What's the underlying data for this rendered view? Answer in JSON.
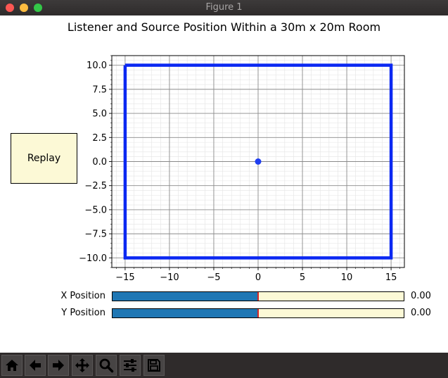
{
  "window": {
    "title": "Figure 1"
  },
  "figure": {
    "title": "Listener and Source Position Within a 30m x 20m Room"
  },
  "replay_button": {
    "label": "Replay"
  },
  "sliders": [
    {
      "label": "X Position",
      "value_text": "0.00",
      "value": 0.0,
      "min": -15,
      "max": 15
    },
    {
      "label": "Y Position",
      "value_text": "0.00",
      "value": 0.0,
      "min": -10,
      "max": 10
    }
  ],
  "toolbar": {
    "buttons": [
      "home-icon",
      "back-arrow-icon",
      "forward-arrow-icon",
      "pan-icon",
      "zoom-icon",
      "configure-subplots-icon",
      "save-icon"
    ]
  },
  "colors": {
    "room": "#0b28f2",
    "listener": "#1f3ef0",
    "slider_fill": "#1f77b4",
    "slider_bg": "#fcf9d6",
    "handle": "#d62728"
  },
  "chart_data": {
    "type": "line",
    "xlim": [
      -16.5,
      16.5
    ],
    "ylim": [
      -11.0,
      11.0
    ],
    "grid": true,
    "minor_grid": true,
    "x_ticks": [
      -15,
      -10,
      -5,
      0,
      5,
      10,
      15
    ],
    "x_tick_labels": [
      "−15",
      "−10",
      "−5",
      "0",
      "5",
      "10",
      "15"
    ],
    "y_ticks": [
      10.0,
      7.5,
      5.0,
      2.5,
      0.0,
      -2.5,
      -5.0,
      -7.5,
      -10.0
    ],
    "y_tick_labels": [
      "10.0",
      "7.5",
      "5.0",
      "2.5",
      "0.0",
      "−2.5",
      "−5.0",
      "−7.5",
      "−10.0"
    ],
    "series": [
      {
        "type": "line",
        "x": [
          -15,
          15,
          15,
          -15,
          -15
        ],
        "y": [
          10,
          10,
          -10,
          -10,
          10
        ]
      },
      {
        "type": "scatter",
        "x": [
          0
        ],
        "y": [
          0
        ]
      }
    ]
  }
}
